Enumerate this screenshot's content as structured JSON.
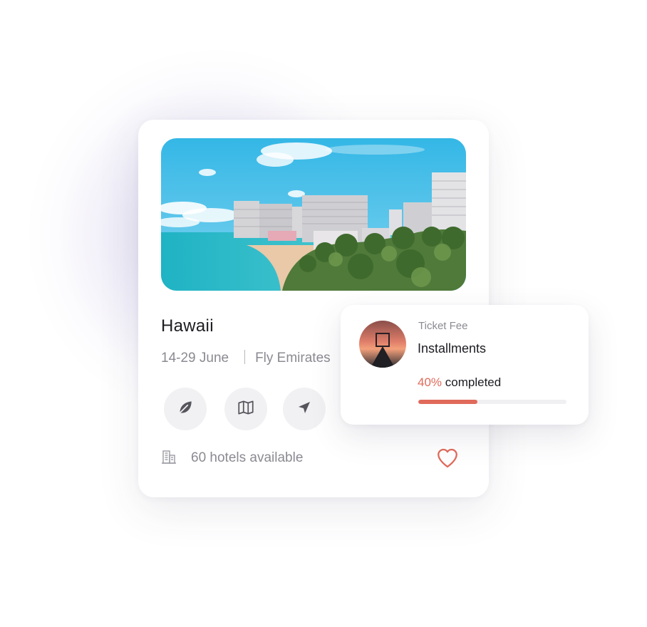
{
  "card": {
    "destination": "Hawaii",
    "dates": "14-29 June",
    "airline": "Fly Emirates",
    "hotels_text": "60 hotels available",
    "action_icons": [
      "leaf-icon",
      "map-icon",
      "send-icon"
    ],
    "accent_color": "#e06a5a"
  },
  "ticket": {
    "label": "Ticket Fee",
    "title": "Installments",
    "percent_text": "40%",
    "status_word": "completed",
    "progress": 0.4
  }
}
